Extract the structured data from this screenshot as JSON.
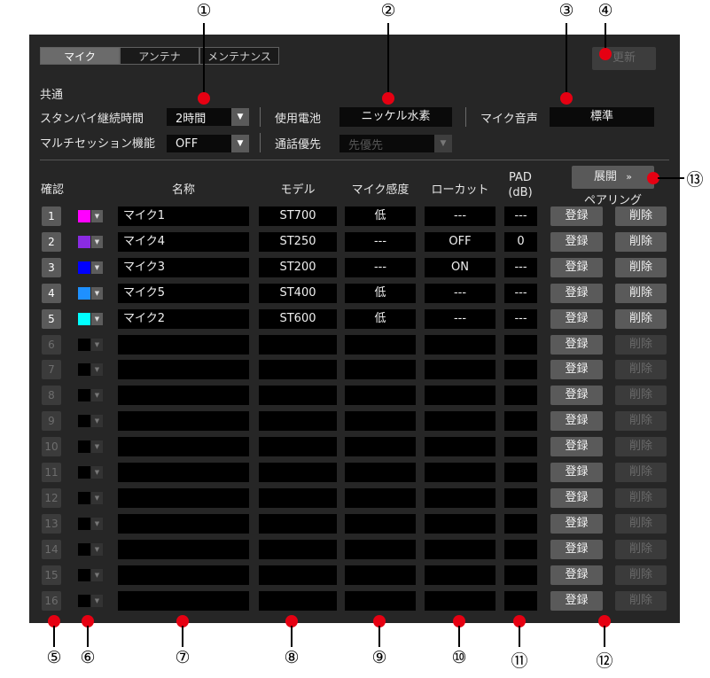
{
  "tabs": [
    {
      "label": "マイク",
      "active": true
    },
    {
      "label": "アンテナ",
      "active": false
    },
    {
      "label": "メンテナンス",
      "active": false
    }
  ],
  "update_button": {
    "label": "更新",
    "enabled": false
  },
  "common": {
    "section_label": "共通",
    "standby_label": "スタンバイ継続時間",
    "standby_value": "2時間",
    "battery_label": "使用電池",
    "battery_value": "ニッケル水素",
    "mic_voice_label": "マイク音声",
    "mic_voice_value": "標準",
    "multisession_label": "マルチセッション機能",
    "multisession_value": "OFF",
    "talk_priority_label": "通話優先",
    "talk_priority_value": "先優先"
  },
  "expand_button": {
    "label": "展開",
    "icon": "double-chevron-down-icon"
  },
  "table": {
    "headers": {
      "confirm": "確認",
      "name": "名称",
      "model": "モデル",
      "sensitivity": "マイク感度",
      "lowcut": "ローカット",
      "pad": "PAD",
      "pad_unit": "(dB)",
      "pairing": "ペアリング"
    },
    "register_label": "登録",
    "delete_label": "削除",
    "rows": [
      {
        "num": "1",
        "color": "#ff00ff",
        "name": "マイク1",
        "model": "ST700",
        "sensitivity": "低",
        "lowcut": "---",
        "pad": "---"
      },
      {
        "num": "2",
        "color": "#8a2be2",
        "name": "マイク4",
        "model": "ST250",
        "sensitivity": "---",
        "lowcut": "OFF",
        "pad": "0"
      },
      {
        "num": "3",
        "color": "#0000ff",
        "name": "マイク3",
        "model": "ST200",
        "sensitivity": "---",
        "lowcut": "ON",
        "pad": "---"
      },
      {
        "num": "4",
        "color": "#1e90ff",
        "name": "マイク5",
        "model": "ST400",
        "sensitivity": "低",
        "lowcut": "---",
        "pad": "---"
      },
      {
        "num": "5",
        "color": "#00ffff",
        "name": "マイク2",
        "model": "ST600",
        "sensitivity": "低",
        "lowcut": "---",
        "pad": "---"
      },
      {
        "num": "6"
      },
      {
        "num": "7"
      },
      {
        "num": "8"
      },
      {
        "num": "9"
      },
      {
        "num": "10"
      },
      {
        "num": "11"
      },
      {
        "num": "12"
      },
      {
        "num": "13"
      },
      {
        "num": "14"
      },
      {
        "num": "15"
      },
      {
        "num": "16"
      }
    ]
  },
  "callouts": [
    "①",
    "②",
    "③",
    "④",
    "⑤",
    "⑥",
    "⑦",
    "⑧",
    "⑨",
    "⑩",
    "⑪",
    "⑫",
    "⑬"
  ],
  "colors": {
    "panel": "#262626",
    "callout_dot": "#e60012"
  }
}
